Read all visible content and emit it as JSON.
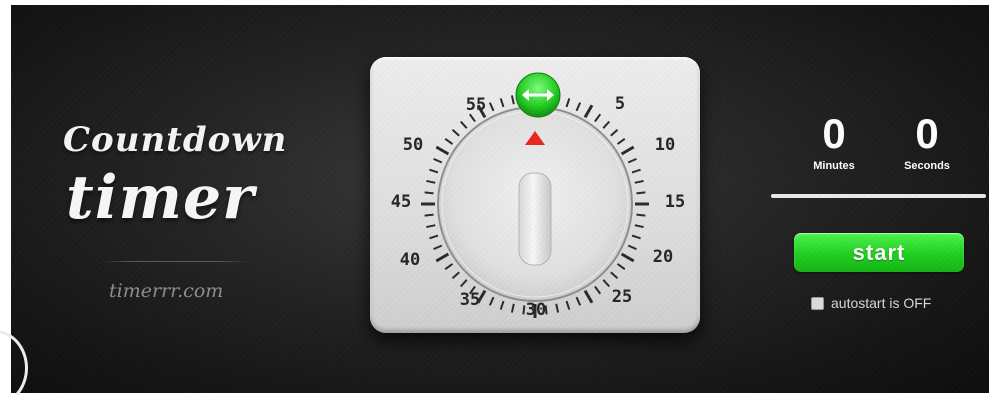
{
  "branding": {
    "line1": "Countdown",
    "line2": "timer",
    "site": "timerrr.com"
  },
  "dial": {
    "numbers": [
      "55",
      "5",
      "50",
      "10",
      "45",
      "15",
      "40",
      "20",
      "35",
      "25",
      "30"
    ],
    "handle_icon": "double-arrow-icon",
    "pointer_icon": "triangle-up-icon",
    "pointer_color": "#e8271d",
    "handle_color": "#2bd62b"
  },
  "time": {
    "minutes": "0",
    "minutes_label": "Minutes",
    "seconds": "0",
    "seconds_label": "Seconds"
  },
  "progress": {
    "value": 1.0,
    "color": "#eaeaea"
  },
  "controls": {
    "start_label": "start",
    "start_color": "#22d022",
    "autostart_label": "autostart is OFF",
    "autostart_checked": false
  }
}
